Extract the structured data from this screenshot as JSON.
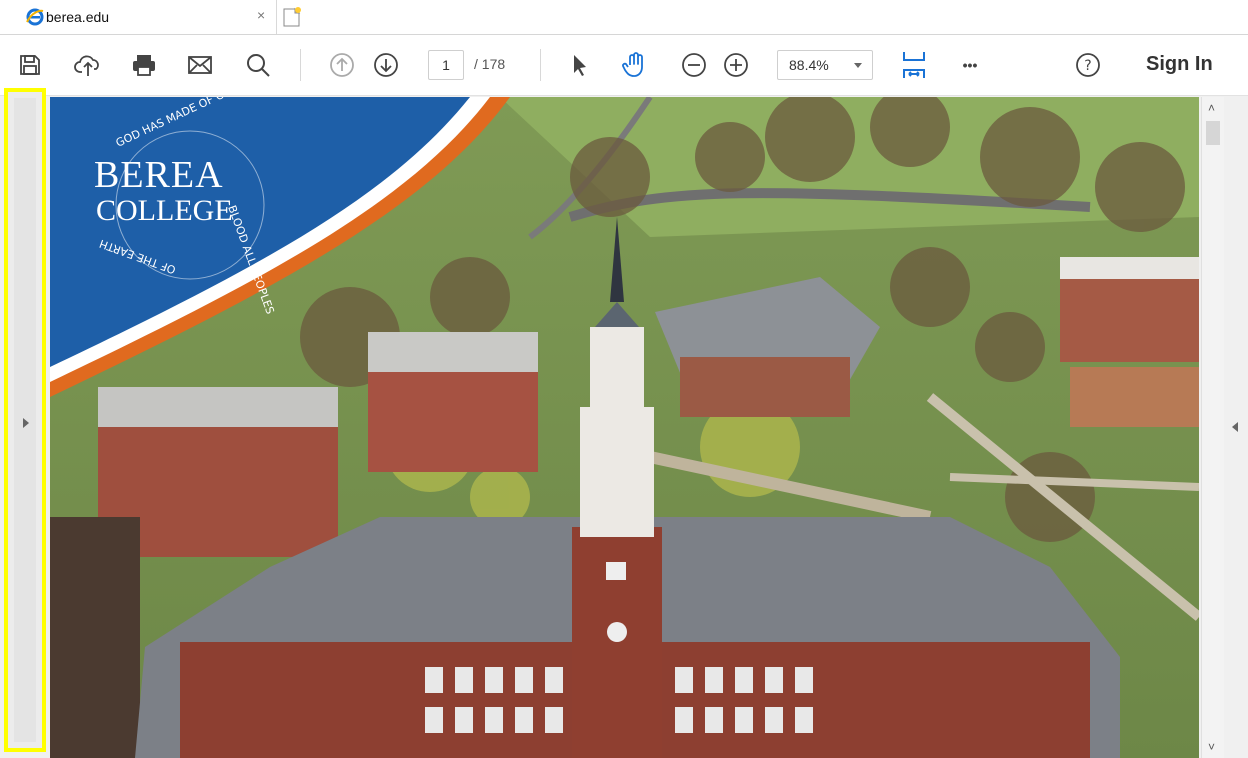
{
  "tab": {
    "title": "berea.edu",
    "close_glyph": "×",
    "icon": "ie-icon"
  },
  "toolbar": {
    "page_current": "1",
    "page_total": "/ 178",
    "zoom": "88.4%",
    "sign_in": "Sign In",
    "more_glyph": "•••",
    "help_glyph": "?"
  },
  "document": {
    "seal_text": "GOD HAS MADE OF ONE BLOOD ALL PEOPLES OF THE EARTH",
    "logo_line1": "BEREA",
    "logo_line2": "COLLEGE"
  },
  "scrollbar": {
    "up_glyph": "˄",
    "down_glyph": "˅"
  },
  "colors": {
    "accent_blue": "#1e5fa8",
    "accent_orange": "#e06a1f",
    "highlight": "#ffff00"
  }
}
